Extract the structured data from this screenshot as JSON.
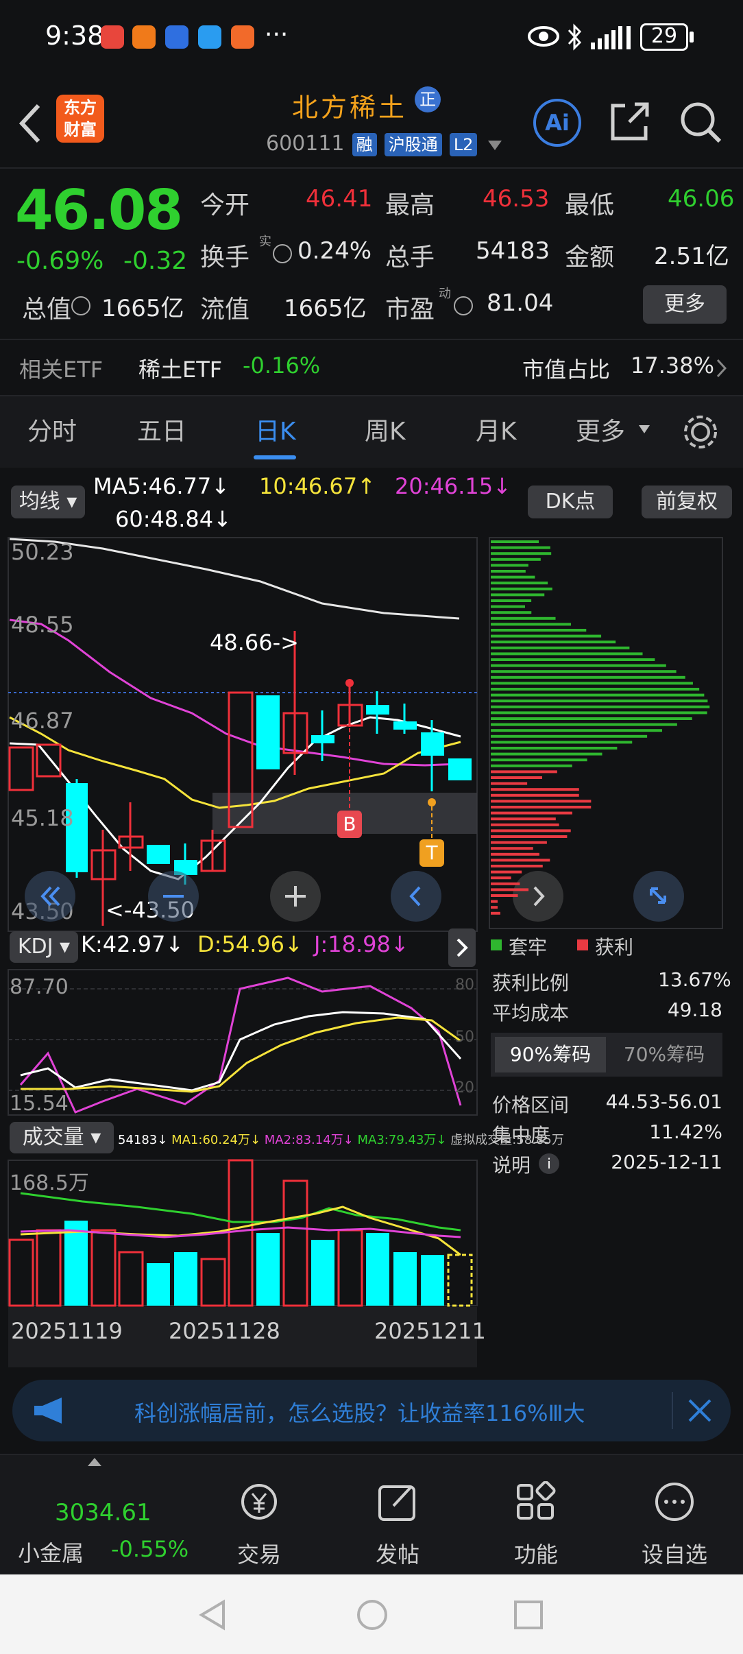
{
  "status_bar": {
    "time": "9:38",
    "dots": "···",
    "battery": "29"
  },
  "header": {
    "logo_line1": "东方",
    "logo_line2": "财富",
    "stock_name": "北方稀土",
    "badge": "正",
    "code": "600111",
    "tags": [
      "融",
      "沪股通",
      "L2"
    ]
  },
  "quote": {
    "price": "46.08",
    "change_pct": "-0.69%",
    "change_abs": "-0.32",
    "open_label": "今开",
    "open": "46.41",
    "high_label": "最高",
    "high": "46.53",
    "low_label": "最低",
    "low": "46.06",
    "turnover_label": "换手",
    "turnover_sup": "实",
    "turnover": "0.24%",
    "volume_label": "总手",
    "volume": "54183",
    "amount_label": "金额",
    "amount": "2.51亿",
    "mktcap_label": "总值",
    "mktcap": "1665亿",
    "float_label": "流值",
    "float": "1665亿",
    "pe_label": "市盈",
    "pe_sup": "动",
    "pe": "81.04",
    "more": "更多"
  },
  "etf": {
    "label": "相关ETF",
    "name": "稀土ETF",
    "change": "-0.16%",
    "ratio_label": "市值占比",
    "ratio": "17.38%"
  },
  "tabs": [
    "分时",
    "五日",
    "日K",
    "周K",
    "月K",
    "更多"
  ],
  "active_tab": "日K",
  "ma_bar": {
    "selector": "均线",
    "ma5": "MA5:46.77↓",
    "ma10": "10:46.67↑",
    "ma20": "20:46.15↓",
    "ma60": "60:48.84↓",
    "dk_button": "DK点",
    "adjust_button": "前复权"
  },
  "price_axis": [
    "50.23",
    "48.55",
    "46.87",
    "45.18",
    "43.50"
  ],
  "annotations": {
    "high": "48.66->",
    "low": "<-43.50",
    "buy": "B",
    "take": "T"
  },
  "kdj_bar": {
    "selector": "KDJ",
    "k": "K:42.97↓",
    "d": "D:54.96↓",
    "j": "J:18.98↓"
  },
  "kdj_axis": {
    "top": "87.70",
    "bottom": "15.54",
    "r80": "80",
    "r50": "50",
    "r20": "20"
  },
  "vol_bar": {
    "selector": "成交量",
    "v": "54183↓",
    "ma1": "MA1:60.24万↓",
    "ma2": "MA2:83.14万↓",
    "ma3": "MA3:79.43万↓",
    "virt": "虚拟成交量:58.85万"
  },
  "vol_axis_top": "168.5万",
  "dates": [
    "20251119",
    "20251128",
    "20251211"
  ],
  "chips": {
    "legend_trapped": "套牢",
    "legend_profit": "获利",
    "rows": [
      {
        "label": "获利比例",
        "value": "13.67%"
      },
      {
        "label": "平均成本",
        "value": "49.18"
      }
    ],
    "tab_90": "90%筹码",
    "tab_70": "70%筹码",
    "rows2": [
      {
        "label": "价格区间",
        "value": "44.53-56.01"
      },
      {
        "label": "集中度",
        "value": "11.42%"
      },
      {
        "label": "说明",
        "value": "2025-12-11"
      }
    ]
  },
  "banner": {
    "text": "科创涨幅居前，怎么选股？让收益率116%Ⅲ大"
  },
  "bottom_nav": {
    "index_value": "3034.61",
    "index_name": "小金属",
    "index_change": "-0.55%",
    "items": [
      "交易",
      "发帖",
      "功能",
      "设自选"
    ]
  },
  "colors": {
    "up": "#f0303a",
    "down": "#00ffff",
    "accent": "#2f7fd8",
    "brand": "#f4a21c"
  }
}
